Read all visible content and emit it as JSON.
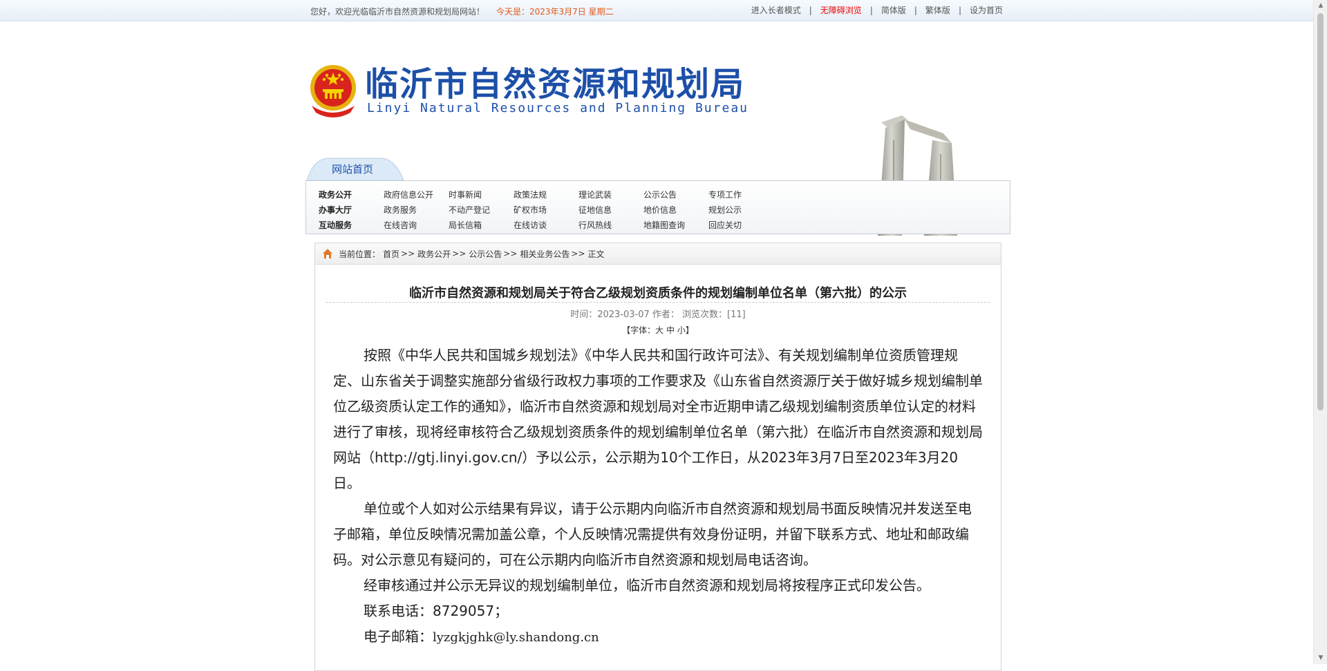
{
  "topbar": {
    "welcome": "您好，欢迎光临临沂市自然资源和规划局网站！",
    "today": "今天是：2023年3月7日 星期二",
    "links": [
      "进入长者模式",
      "无障碍浏览",
      "简体版",
      "繁体版",
      "设为首页"
    ]
  },
  "header": {
    "title": "临沂市自然资源和规划局",
    "subtitle": "Linyi Natural Resources and Planning Bureau"
  },
  "nav": {
    "home_tab": "网站首页",
    "rows": [
      {
        "head": "政务公开",
        "items": [
          "政府信息公开",
          "时事新闻",
          "政策法规",
          "理论武装",
          "公示公告",
          "专项工作"
        ]
      },
      {
        "head": "办事大厅",
        "items": [
          "政务服务",
          "不动产登记",
          "矿权市场",
          "征地信息",
          "地价信息",
          "规划公示"
        ]
      },
      {
        "head": "互动服务",
        "items": [
          "在线咨询",
          "局长信箱",
          "在线访谈",
          "行风热线",
          "地籍图查询",
          "回应关切"
        ]
      }
    ]
  },
  "breadcrumb": {
    "label": "当前位置：",
    "items": [
      "首页",
      "政务公开",
      "公示公告",
      "相关业务公告",
      "正文"
    ],
    "separator": ">>"
  },
  "article": {
    "title": "临沂市自然资源和规划局关于符合乙级规划资质条件的规划编制单位名单（第六批）的公示",
    "meta": "时间：2023-03-07 作者：  浏览次数：[11]",
    "font_label_open": "【字体：",
    "font_sizes": [
      "大",
      "中",
      "小"
    ],
    "font_label_close": "】",
    "paragraphs": [
      "按照《中华人民共和国城乡规划法》《中华人民共和国行政许可法》、有关规划编制单位资质管理规定、山东省关于调整实施部分省级行政权力事项的工作要求及《山东省自然资源厅关于做好城乡规划编制单位乙级资质认定工作的通知》，临沂市自然资源和规划局对全市近期申请乙级规划编制资质单位认定的材料进行了审核，现将经审核符合乙级规划资质条件的规划编制单位名单（第六批）在临沂市自然资源和规划局网站（http://gtj.linyi.gov.cn/）予以公示，公示期为10个工作日，从2023年3月7日至2023年3月20日。",
      "单位或个人如对公示结果有异议，请于公示期内向临沂市自然资源和规划局书面反映情况并发送至电子邮箱，单位反映情况需加盖公章，个人反映情况需提供有效身份证明，并留下联系方式、地址和邮政编码。对公示意见有疑问的，可在公示期内向临沂市自然资源和规划局电话咨询。",
      "经审核通过并公示无异议的规划编制单位，临沂市自然资源和规划局将按程序正式印发公告。",
      "联系电话：8729057；"
    ],
    "email_label": "电子邮箱：",
    "email": "lyzgkjghk@ly.shandong.cn"
  },
  "colors": {
    "brand_blue": "#1c4fa8",
    "today_orange": "#e0591b",
    "accessibility_red": "#ee0000"
  }
}
